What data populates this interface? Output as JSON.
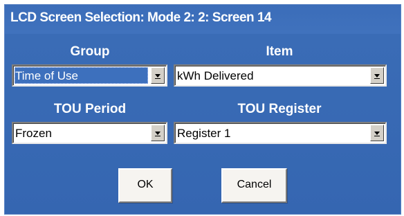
{
  "window": {
    "title": "LCD Screen Selection: Mode 2: 2: Screen 14"
  },
  "group": {
    "label": "Group",
    "value": "Time of Use"
  },
  "item": {
    "label": "Item",
    "value": "kWh Delivered"
  },
  "tou_period": {
    "label": "TOU Period",
    "value": "Frozen"
  },
  "tou_register": {
    "label": "TOU Register",
    "value": "Register 1"
  },
  "buttons": {
    "ok_label": "OK",
    "cancel_label": "Cancel"
  },
  "icons": {
    "dropdown": "chevron-down-icon"
  },
  "colors": {
    "dialog_background": "#3a6cb6",
    "selection_highlight": "#3d70bd",
    "button_face": "#f6f4f0"
  }
}
